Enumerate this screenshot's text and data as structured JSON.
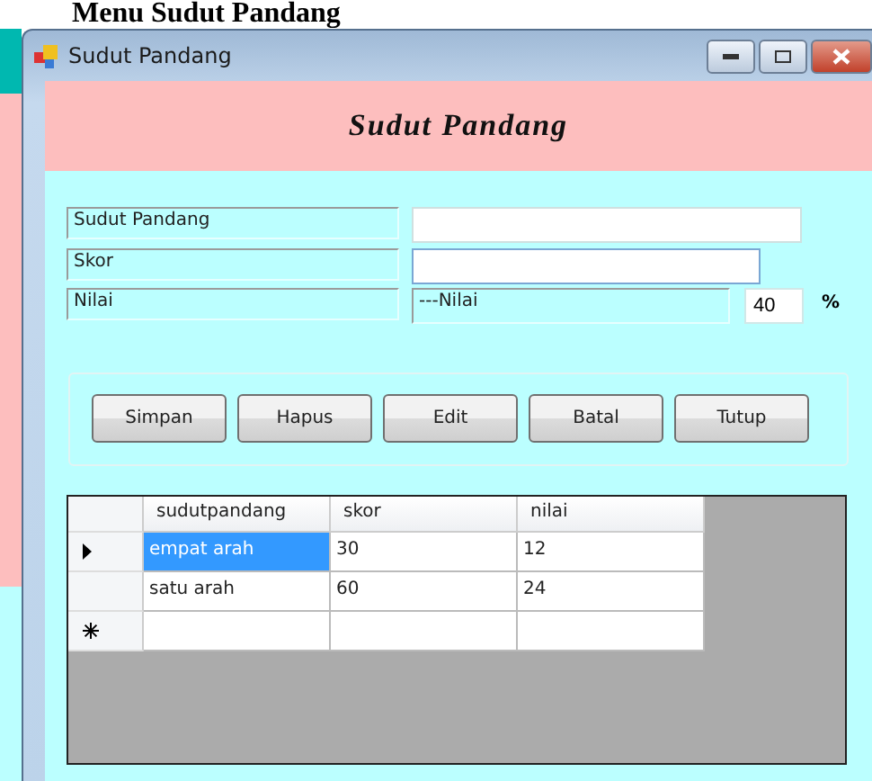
{
  "page_heading": "Menu Sudut Pandang",
  "window": {
    "title": "Sudut Pandang"
  },
  "banner": "Sudut Pandang",
  "fields": [
    {
      "label": "Sudut Pandang",
      "kind": "input",
      "focused": false
    },
    {
      "label": "Skor",
      "kind": "input",
      "focused": true
    },
    {
      "label": "Nilai",
      "kind": "readout",
      "value": "---Nilai",
      "percent": "40",
      "unit": "%"
    }
  ],
  "buttons": [
    "Simpan",
    "Hapus",
    "Edit",
    "Batal",
    "Tutup"
  ],
  "grid": {
    "columns": [
      "sudutpandang",
      "skor",
      "nilai"
    ],
    "rows": [
      {
        "cells": [
          "empat arah",
          "30",
          "12"
        ],
        "current": true
      },
      {
        "cells": [
          "satu arah",
          "60",
          "24"
        ],
        "current": false
      }
    ],
    "new_row": true
  }
}
